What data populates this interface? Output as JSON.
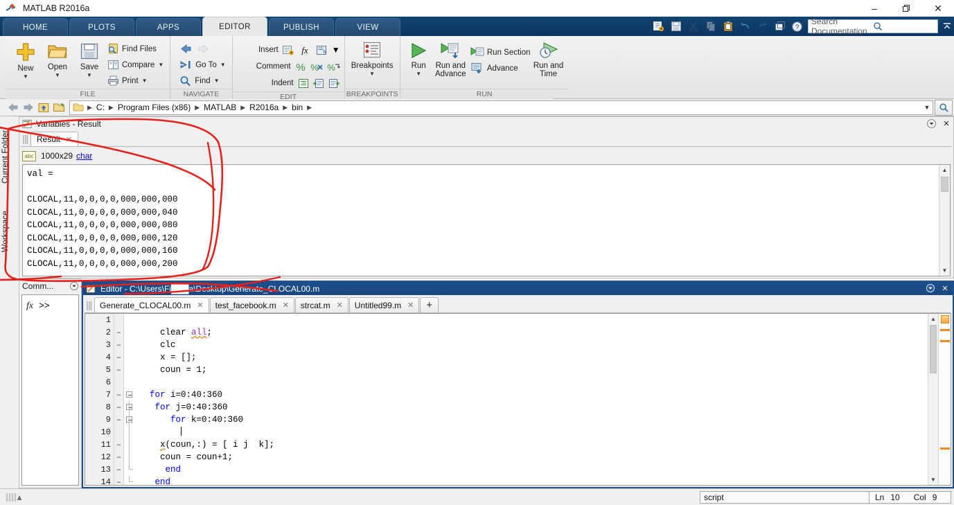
{
  "window": {
    "title": "MATLAB R2016a",
    "logo_icon": "matlab-logo-icon",
    "minimize_label": "–",
    "restore_label": "❐",
    "close_label": "✕"
  },
  "ribbon_tabs": [
    {
      "label": "HOME",
      "active": false
    },
    {
      "label": "PLOTS",
      "active": false
    },
    {
      "label": "APPS",
      "active": false
    },
    {
      "label": "EDITOR",
      "active": true
    },
    {
      "label": "PUBLISH",
      "active": false
    },
    {
      "label": "VIEW",
      "active": false
    }
  ],
  "quick_access": {
    "icons": [
      "new-script-icon",
      "save-icon",
      "cut-icon",
      "copy-icon",
      "paste-icon",
      "undo-icon",
      "redo-icon",
      "switch-windows-icon",
      "help-icon"
    ],
    "search_placeholder": "Search Documentation",
    "search_value": "",
    "search_icon": "magnifier-icon",
    "collapse_icon": "collapse-ribbon-icon"
  },
  "ribbon": {
    "groups": [
      {
        "name": "FILE",
        "label": "FILE",
        "big_buttons": [
          {
            "label": "New",
            "icon": "new-plus-icon",
            "has_caret": true
          },
          {
            "label": "Open",
            "icon": "open-folder-icon",
            "has_caret": true
          },
          {
            "label": "Save",
            "icon": "save-disk-icon",
            "has_caret": true
          }
        ],
        "small_buttons": [
          {
            "label": "Find Files",
            "icon": "find-files-icon",
            "has_caret": false
          },
          {
            "label": "Compare",
            "icon": "compare-icon",
            "has_caret": true
          },
          {
            "label": "Print",
            "icon": "print-icon",
            "has_caret": true
          }
        ]
      },
      {
        "name": "NAVIGATE",
        "label": "NAVIGATE",
        "small_buttons": [
          {
            "label": "",
            "icon": "back-arrow-icon",
            "has_caret": false
          },
          {
            "label": "",
            "icon": "forward-arrow-icon",
            "has_caret": false
          },
          {
            "label": "Go To",
            "icon": "go-to-icon",
            "has_caret": true
          },
          {
            "label": "Find",
            "icon": "find-icon",
            "has_caret": true
          }
        ]
      },
      {
        "name": "EDIT",
        "label": "EDIT",
        "rows": [
          {
            "label": "Insert",
            "icons": [
              "insert-icon",
              "fx-function-icon",
              "insert-block-icon"
            ],
            "has_caret": true
          },
          {
            "label": "Comment",
            "icons": [
              "comment-percent-icon",
              "uncomment-icon",
              "wrap-comment-icon"
            ],
            "has_caret": false
          },
          {
            "label": "Indent",
            "icons": [
              "smart-indent-icon",
              "indent-right-icon",
              "indent-left-icon"
            ],
            "has_caret": false
          }
        ]
      },
      {
        "name": "BREAKPOINTS",
        "label": "BREAKPOINTS",
        "big_buttons": [
          {
            "label": "Breakpoints",
            "icon": "breakpoints-icon",
            "has_caret": true
          }
        ]
      },
      {
        "name": "RUN",
        "label": "RUN",
        "big_buttons": [
          {
            "label": "Run",
            "icon": "run-icon",
            "has_caret": true
          },
          {
            "label": "Run and\nAdvance",
            "icon": "run-advance-icon",
            "has_caret": false
          },
          {
            "label": "Run and\nTime",
            "icon": "run-time-icon",
            "has_caret": false
          }
        ],
        "small_buttons": [
          {
            "label": "Run Section",
            "icon": "run-section-icon",
            "has_caret": false
          },
          {
            "label": "Advance",
            "icon": "advance-icon",
            "has_caret": false
          }
        ]
      }
    ]
  },
  "address_bar": {
    "back_icon": "back-arrow-icon",
    "forward_icon": "forward-arrow-icon",
    "up_icon": "up-folder-icon",
    "browse_icon": "browse-folder-icon",
    "folder_icon": "folder-icon",
    "crumbs": [
      "C:",
      "Program Files (x86)",
      "MATLAB",
      "R2016a",
      "bin"
    ],
    "dropdown_icon": "chevron-down-icon",
    "search_icon": "magnifier-icon"
  },
  "left_dock": {
    "tabs": [
      {
        "label": "Current Folder",
        "name": "sidebar-tab-current-folder"
      },
      {
        "label": "Workspace",
        "name": "sidebar-tab-workspace"
      }
    ]
  },
  "variables_panel": {
    "title": "Variables - Result",
    "title_icon": "variables-icon",
    "dropdown_icon": "panel-menu-icon",
    "close_icon": "close-icon",
    "tab": {
      "label": "Result",
      "close_icon": "close-icon"
    },
    "meta": {
      "type_icon": "abc",
      "size": "1000x29",
      "type": "char"
    },
    "content_lines": [
      "val =",
      "",
      "CLOCAL,11,0,0,0,0,000,000,000",
      "CLOCAL,11,0,0,0,0,000,000,040",
      "CLOCAL,11,0,0,0,0,000,000,080",
      "CLOCAL,11,0,0,0,0,000,000,120",
      "CLOCAL,11,0,0,0,0,000,000,160",
      "CLOCAL,11,0,0,0,0,000,000,200"
    ],
    "scroll_up_icon": "chevron-up-icon",
    "scroll_down_icon": "chevron-down-icon"
  },
  "command_window": {
    "title": "Comm...",
    "dropdown_icon": "panel-menu-icon",
    "fx_label": "fx",
    "prompt": ">>"
  },
  "editor_panel": {
    "title": "Editor - C:\\Users\\Fi███a\\Desktop\\Generate_CLOCAL00.m",
    "title_icon": "editor-icon",
    "dropdown_icon": "panel-menu-icon",
    "close_icon": "close-icon",
    "tabs": [
      {
        "label": "Generate_CLOCAL00.m",
        "active": true,
        "close_icon": "close-icon"
      },
      {
        "label": "test_facebook.m",
        "active": false,
        "close_icon": "close-icon"
      },
      {
        "label": "strcat.m",
        "active": false,
        "close_icon": "close-icon"
      },
      {
        "label": "Untitled99.m",
        "active": false,
        "close_icon": "close-icon"
      }
    ],
    "new_tab_label": "+",
    "code_lines": [
      {
        "num": "1",
        "executable": false,
        "fold": "none",
        "text": ""
      },
      {
        "num": "2",
        "executable": true,
        "fold": "none",
        "text": "    clear all;"
      },
      {
        "num": "3",
        "executable": true,
        "fold": "none",
        "text": "    clc"
      },
      {
        "num": "4",
        "executable": true,
        "fold": "none",
        "text": "    x = [];"
      },
      {
        "num": "5",
        "executable": true,
        "fold": "none",
        "text": "    coun = 1;"
      },
      {
        "num": "6",
        "executable": false,
        "fold": "none",
        "text": ""
      },
      {
        "num": "7",
        "executable": true,
        "fold": "open",
        "text": "  for i=0:40:360"
      },
      {
        "num": "8",
        "executable": true,
        "fold": "open",
        "text": "   for j=0:40:360"
      },
      {
        "num": "9",
        "executable": true,
        "fold": "open",
        "text": "      for k=0:40:360"
      },
      {
        "num": "10",
        "executable": false,
        "fold": "line",
        "text": ""
      },
      {
        "num": "11",
        "executable": true,
        "fold": "line",
        "text": "    x(coun,:) = [ i j  k];"
      },
      {
        "num": "12",
        "executable": true,
        "fold": "line",
        "text": "    coun = coun+1;"
      },
      {
        "num": "13",
        "executable": true,
        "fold": "end",
        "text": "     end"
      },
      {
        "num": "14",
        "executable": true,
        "fold": "end",
        "text": "   end"
      }
    ],
    "executable_marker": "–",
    "scroll_up_icon": "chevron-up-icon",
    "scroll_down_icon": "chevron-down-icon"
  },
  "status_bar": {
    "resize_icon": "resize-grip-icon",
    "file_type": "script",
    "line_label": "Ln",
    "line_value": "10",
    "col_label": "Col",
    "col_value": "9"
  },
  "annotation": {
    "name": "red-handdrawn-circle",
    "color": "#e8201a"
  },
  "colors": {
    "ribbon_blue": "#12446f",
    "editor_title_blue": "#1d4f8c",
    "keyword_blue": "#0000ff",
    "link_blue": "#0000cc",
    "warning_orange": "#f08c1b",
    "annotation_red": "#e8201a"
  }
}
